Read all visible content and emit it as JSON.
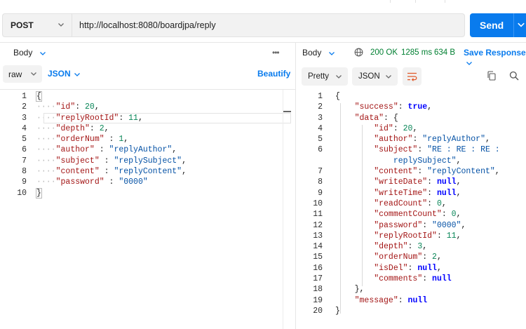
{
  "request": {
    "method": "POST",
    "url": "http://localhost:8080/boardjpa/reply",
    "send_label": "Send"
  },
  "request_body": {
    "tab_label": "Body",
    "mode": "raw",
    "language": "JSON",
    "beautify_label": "Beautify",
    "more_label": "•••",
    "line_numbers": [
      "1",
      "2",
      "3",
      "4",
      "5",
      "6",
      "7",
      "8",
      "9",
      "10"
    ],
    "lines": [
      {
        "key": "",
        "sep": "",
        "value": "",
        "raw": "{"
      },
      {
        "key": "\"id\"",
        "sep": ": ",
        "value": "20",
        "end": ",",
        "type": "n"
      },
      {
        "key": "\"replyRootId\"",
        "sep": ": ",
        "value": "11",
        "end": ",",
        "type": "n"
      },
      {
        "key": "\"depth\"",
        "sep": ": ",
        "value": "2",
        "end": ",",
        "type": "n"
      },
      {
        "key": "\"orderNum\"",
        "sep": " : ",
        "value": "1",
        "end": ",",
        "type": "n"
      },
      {
        "key": "\"author\"",
        "sep": " : ",
        "value": "\"replyAuthor\"",
        "end": ",",
        "type": "s"
      },
      {
        "key": "\"subject\"",
        "sep": " : ",
        "value": "\"replySubject\"",
        "end": ",",
        "type": "s"
      },
      {
        "key": "\"content\"",
        "sep": " : ",
        "value": "\"replyContent\"",
        "end": ",",
        "type": "s"
      },
      {
        "key": "\"password\"",
        "sep": " : ",
        "value": "\"0000\"",
        "end": "",
        "type": "s"
      },
      {
        "raw": "}"
      }
    ]
  },
  "response": {
    "tab_label": "Body",
    "status": "200 OK",
    "time": "1285 ms",
    "size": "634 B",
    "save_label": "Save Response",
    "view_mode": "Pretty",
    "language": "JSON",
    "line_numbers": [
      "1",
      "2",
      "3",
      "4",
      "5",
      "6",
      "",
      "7",
      "8",
      "9",
      "10",
      "11",
      "12",
      "13",
      "14",
      "15",
      "16",
      "17",
      "18",
      "19",
      "20"
    ],
    "lines": [
      {
        "indent": 0,
        "raw": "{"
      },
      {
        "indent": 1,
        "key": "\"success\"",
        "sep": ": ",
        "value": "true",
        "end": ",",
        "type": "kw"
      },
      {
        "indent": 1,
        "key": "\"data\"",
        "sep": ": ",
        "value": "{",
        "end": "",
        "type": "p"
      },
      {
        "indent": 2,
        "key": "\"id\"",
        "sep": ": ",
        "value": "20",
        "end": ",",
        "type": "n"
      },
      {
        "indent": 2,
        "key": "\"author\"",
        "sep": ": ",
        "value": "\"replyAuthor\"",
        "end": ",",
        "type": "s"
      },
      {
        "indent": 2,
        "key": "\"subject\"",
        "sep": ": ",
        "value": "\"RE : RE : RE :",
        "end": "",
        "type": "s"
      },
      {
        "indent": 3,
        "key": "",
        "sep": "",
        "value": "replySubject\"",
        "end": ",",
        "type": "s"
      },
      {
        "indent": 2,
        "key": "\"content\"",
        "sep": ": ",
        "value": "\"replyContent\"",
        "end": ",",
        "type": "s"
      },
      {
        "indent": 2,
        "key": "\"writeDate\"",
        "sep": ": ",
        "value": "null",
        "end": ",",
        "type": "kw"
      },
      {
        "indent": 2,
        "key": "\"writeTime\"",
        "sep": ": ",
        "value": "null",
        "end": ",",
        "type": "kw"
      },
      {
        "indent": 2,
        "key": "\"readCount\"",
        "sep": ": ",
        "value": "0",
        "end": ",",
        "type": "n"
      },
      {
        "indent": 2,
        "key": "\"commentCount\"",
        "sep": ": ",
        "value": "0",
        "end": ",",
        "type": "n"
      },
      {
        "indent": 2,
        "key": "\"password\"",
        "sep": ": ",
        "value": "\"0000\"",
        "end": ",",
        "type": "s"
      },
      {
        "indent": 2,
        "key": "\"replyRootId\"",
        "sep": ": ",
        "value": "11",
        "end": ",",
        "type": "n"
      },
      {
        "indent": 2,
        "key": "\"depth\"",
        "sep": ": ",
        "value": "3",
        "end": ",",
        "type": "n"
      },
      {
        "indent": 2,
        "key": "\"orderNum\"",
        "sep": ": ",
        "value": "2",
        "end": ",",
        "type": "n"
      },
      {
        "indent": 2,
        "key": "\"isDel\"",
        "sep": ": ",
        "value": "null",
        "end": ",",
        "type": "kw"
      },
      {
        "indent": 2,
        "key": "\"comments\"",
        "sep": ": ",
        "value": "null",
        "end": "",
        "type": "kw"
      },
      {
        "indent": 1,
        "raw": "},"
      },
      {
        "indent": 1,
        "key": "\"message\"",
        "sep": ": ",
        "value": "null",
        "end": "",
        "type": "kw"
      },
      {
        "indent": 0,
        "raw": "}"
      }
    ]
  },
  "icons": {
    "globe": "globe-icon",
    "wrap": "wrap-lines-icon",
    "copy": "copy-icon",
    "search": "search-icon",
    "chevron": "chevron-down-icon"
  },
  "colors": {
    "accent": "#097bed",
    "status_ok": "#007f31",
    "json_key": "#a31515",
    "json_number": "#098658",
    "json_string": "#0451a5",
    "json_keyword": "#0000ff"
  }
}
